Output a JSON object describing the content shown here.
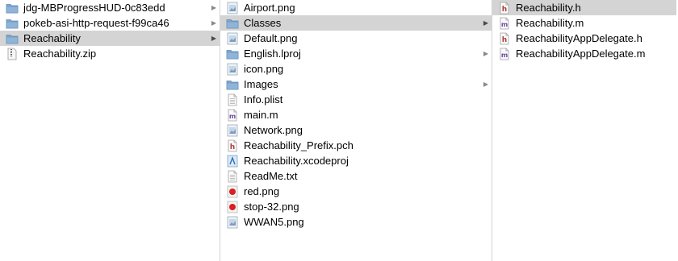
{
  "columns": [
    {
      "items": [
        {
          "label": "jdg-MBProgressHUD-0c83edd",
          "icon": "folder-icon",
          "has_children": true,
          "selected": false
        },
        {
          "label": "pokeb-asi-http-request-f99ca46",
          "icon": "folder-icon",
          "has_children": true,
          "selected": false
        },
        {
          "label": "Reachability",
          "icon": "folder-icon",
          "has_children": true,
          "selected": true
        },
        {
          "label": "Reachability.zip",
          "icon": "zip-file-icon",
          "has_children": false,
          "selected": false
        }
      ]
    },
    {
      "items": [
        {
          "label": "Airport.png",
          "icon": "image-file-icon",
          "has_children": false,
          "selected": false
        },
        {
          "label": "Classes",
          "icon": "folder-icon",
          "has_children": true,
          "selected": true
        },
        {
          "label": "Default.png",
          "icon": "image-file-icon",
          "has_children": false,
          "selected": false
        },
        {
          "label": "English.lproj",
          "icon": "folder-icon",
          "has_children": true,
          "selected": false
        },
        {
          "label": "icon.png",
          "icon": "image-file-icon",
          "has_children": false,
          "selected": false
        },
        {
          "label": "Images",
          "icon": "folder-icon",
          "has_children": true,
          "selected": false
        },
        {
          "label": "Info.plist",
          "icon": "plist-file-icon",
          "has_children": false,
          "selected": false
        },
        {
          "label": "main.m",
          "icon": "m-file-icon",
          "has_children": false,
          "selected": false
        },
        {
          "label": "Network.png",
          "icon": "image-file-icon",
          "has_children": false,
          "selected": false
        },
        {
          "label": "Reachability_Prefix.pch",
          "icon": "h-file-icon",
          "has_children": false,
          "selected": false
        },
        {
          "label": "Reachability.xcodeproj",
          "icon": "xcodeproj-file-icon",
          "has_children": false,
          "selected": false
        },
        {
          "label": "ReadMe.txt",
          "icon": "text-file-icon",
          "has_children": false,
          "selected": false
        },
        {
          "label": "red.png",
          "icon": "red-dot-image-icon",
          "has_children": false,
          "selected": false
        },
        {
          "label": "stop-32.png",
          "icon": "red-dot-image-icon",
          "has_children": false,
          "selected": false
        },
        {
          "label": "WWAN5.png",
          "icon": "image-file-icon",
          "has_children": false,
          "selected": false
        }
      ]
    },
    {
      "items": [
        {
          "label": "Reachability.h",
          "icon": "h-file-icon",
          "has_children": false,
          "selected": true
        },
        {
          "label": "Reachability.m",
          "icon": "m-file-icon",
          "has_children": false,
          "selected": false
        },
        {
          "label": "ReachabilityAppDelegate.h",
          "icon": "h-file-icon",
          "has_children": false,
          "selected": false
        },
        {
          "label": "ReachabilityAppDelegate.m",
          "icon": "m-file-icon",
          "has_children": false,
          "selected": false
        }
      ]
    }
  ],
  "colors": {
    "selection": "#d4d4d4",
    "folder": "#8fb4d8",
    "h_letter": "#b23a3a",
    "m_letter": "#6b4aa8",
    "red_dot": "#d91f1f"
  },
  "glyphs": {
    "chevron": "▶",
    "h_letter": "h",
    "m_letter": "m"
  }
}
